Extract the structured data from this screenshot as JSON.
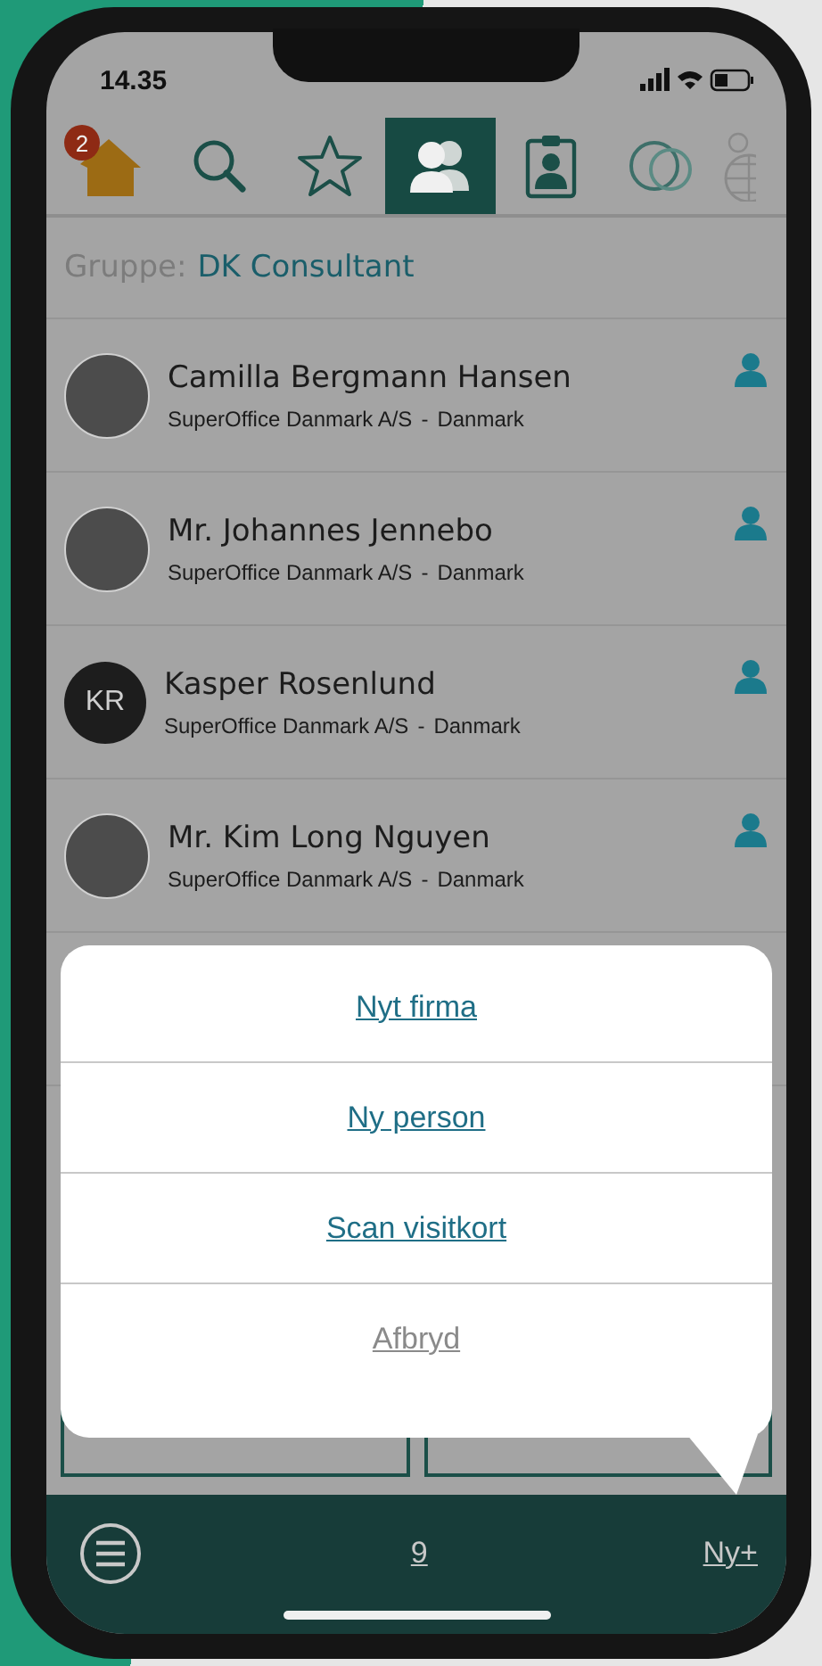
{
  "status_bar": {
    "time": "14.35"
  },
  "tabs": [
    {
      "kind": "home",
      "badge": "2",
      "selected": false
    },
    {
      "kind": "search",
      "selected": false
    },
    {
      "kind": "star",
      "selected": false
    },
    {
      "kind": "people",
      "selected": true
    },
    {
      "kind": "idcard",
      "selected": false
    },
    {
      "kind": "circles",
      "selected": false
    },
    {
      "kind": "globe",
      "selected": false
    }
  ],
  "group": {
    "label": "Gruppe:",
    "value": "DK Consultant"
  },
  "contacts": [
    {
      "name": "Camilla Bergmann Hansen",
      "company": "SuperOffice Danmark A/S",
      "separator": "-",
      "country": "Danmark",
      "kind": "photo"
    },
    {
      "name": "Mr. Johannes Jennebo",
      "company": "SuperOffice Danmark A/S",
      "separator": "-",
      "country": "Danmark",
      "kind": "photo"
    },
    {
      "name": "Kasper Rosenlund",
      "company": "SuperOffice Danmark A/S",
      "separator": "-",
      "country": "Danmark",
      "kind": "initials",
      "initials": "KR"
    },
    {
      "name": "Mr. Kim Long Nguyen",
      "company": "SuperOffice Danmark A/S",
      "separator": "-",
      "country": "Danmark",
      "kind": "photo"
    }
  ],
  "action_sheet": {
    "items": [
      {
        "label": "Nyt firma",
        "kind": "action"
      },
      {
        "label": "Ny person",
        "kind": "action"
      },
      {
        "label": "Scan visitkort",
        "kind": "action"
      },
      {
        "label": "Afbryd",
        "kind": "cancel"
      }
    ]
  },
  "bottom_bar": {
    "count": "9",
    "new_label": "Ny+"
  }
}
